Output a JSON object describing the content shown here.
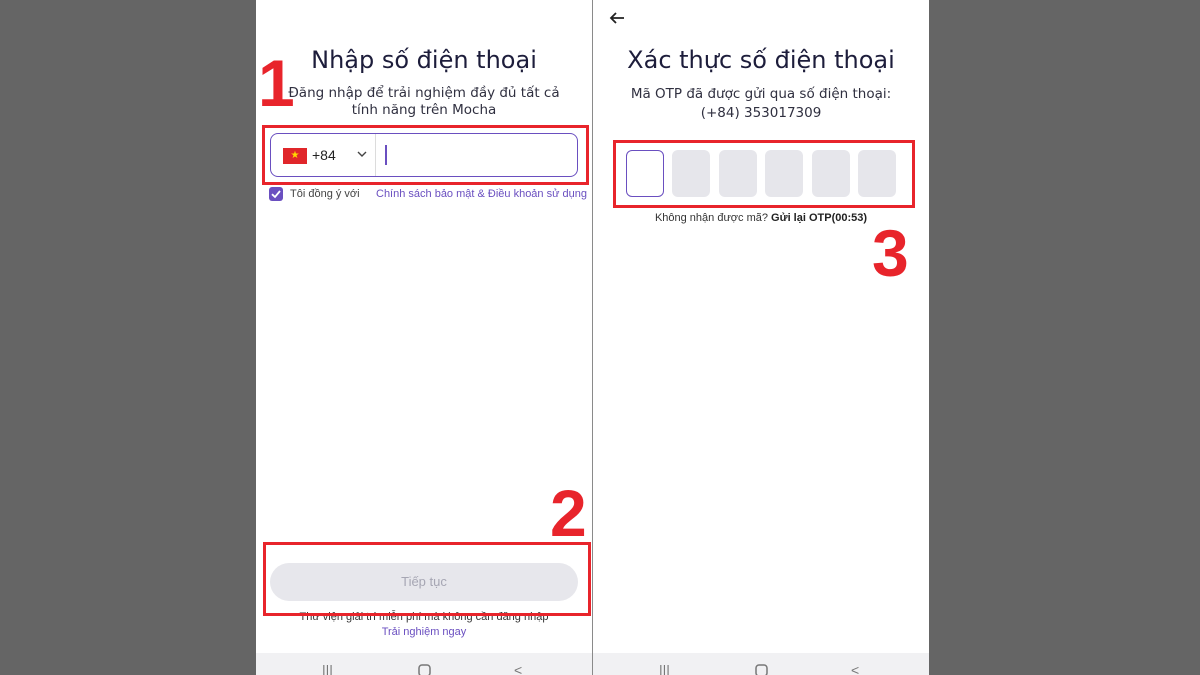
{
  "screen1": {
    "title": "Nhập số điện thoại",
    "subtitle": "Đăng nhập để trải nghiệm đầy đủ tất cả tính năng trên Mocha",
    "country_code": "+84",
    "flag_icon": "vietnam-flag-icon",
    "phone_value": "",
    "agree_text": "Tôi đồng ý với",
    "agree_link": "Chính sách bảo mật & Điều khoản sử dụng",
    "agree_checked": true,
    "continue_label": "Tiếp tục",
    "free_text": "Thư viện giải trí miễn phí mà không cần đăng nhập",
    "try_link": "Trải nghiệm ngay"
  },
  "screen2": {
    "title": "Xác thực số điện thoại",
    "subtitle": "Mã OTP đã được gửi qua số điện thoại:",
    "phone": "(+84) 353017309",
    "otp_digits": [
      "",
      "",
      "",
      "",
      "",
      ""
    ],
    "resend_prefix": "Không nhận được mã?",
    "resend_label": "Gửi lại OTP(00:53)"
  },
  "navbar": {
    "icons": [
      "recent-apps-icon",
      "home-icon",
      "back-icon"
    ],
    "recent": "|||",
    "back": "<"
  },
  "annotations": {
    "labels": [
      "1",
      "2",
      "3"
    ],
    "color": "#e8242b"
  },
  "colors": {
    "accent": "#6a4fc0",
    "background": "#656565",
    "annotation": "#e8242b"
  }
}
